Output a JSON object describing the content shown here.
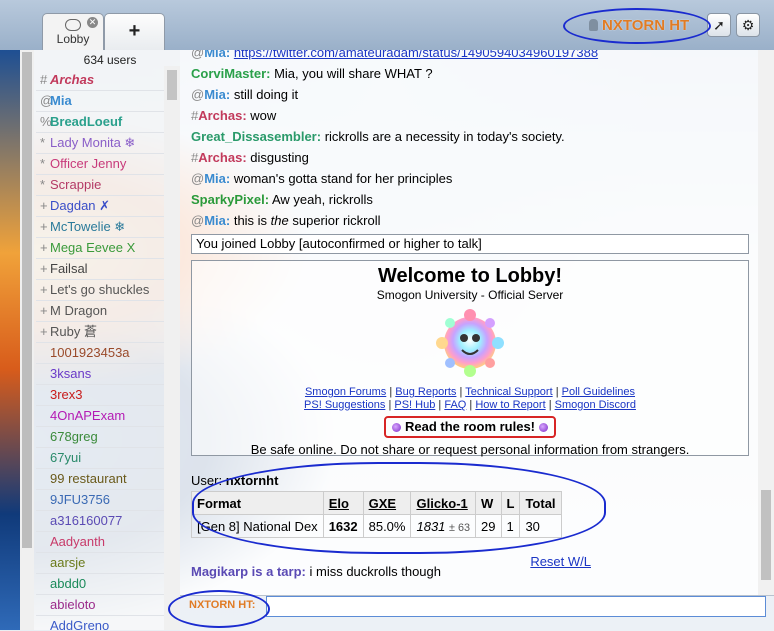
{
  "header": {
    "tabs": [
      {
        "label": "Lobby"
      }
    ],
    "add_tab_label": "+",
    "username": "NXTORN HT",
    "pm_icon": "arrow-icon",
    "settings_icon": "gear-icon"
  },
  "userlist": {
    "count_label": "634 users",
    "users": [
      {
        "rank": "#",
        "name": "Archas",
        "color": "#c23a5c",
        "style": "bolditalic"
      },
      {
        "rank": "@",
        "name": "Mia",
        "color": "#3a8bd0",
        "style": "bold"
      },
      {
        "rank": "%",
        "name": "BreadLoeuf",
        "color": "#2aa08c",
        "style": "bold"
      },
      {
        "rank": "*",
        "name": "Lady Monita ❄",
        "color": "#8a5ec8",
        "style": ""
      },
      {
        "rank": "*",
        "name": "Officer Jenny",
        "color": "#c83a7a",
        "style": ""
      },
      {
        "rank": "*",
        "name": "Scrappie",
        "color": "#b43a66",
        "style": ""
      },
      {
        "rank": "+",
        "name": "Dagdan ✗",
        "color": "#3a4ec8",
        "style": ""
      },
      {
        "rank": "+",
        "name": "McTowelie ❄",
        "color": "#2a7a9a",
        "style": ""
      },
      {
        "rank": "+",
        "name": "Mega Eevee X",
        "color": "#3a9a3a",
        "style": ""
      },
      {
        "rank": "+",
        "name": "Failsal",
        "color": "#444444",
        "style": ""
      },
      {
        "rank": "+",
        "name": "Let's go shuckles",
        "color": "#555555",
        "style": ""
      },
      {
        "rank": "+",
        "name": "M Dragon",
        "color": "#555555",
        "style": ""
      },
      {
        "rank": "+",
        "name": "Ruby 蒼",
        "color": "#555555",
        "style": ""
      },
      {
        "rank": "",
        "name": "1001923453a",
        "color": "#9a4a2a",
        "style": ""
      },
      {
        "rank": "",
        "name": "3ksans",
        "color": "#6a3ac8",
        "style": ""
      },
      {
        "rank": "",
        "name": "3rex3",
        "color": "#c81a1a",
        "style": ""
      },
      {
        "rank": "",
        "name": "4OnAPExam",
        "color": "#b41ab4",
        "style": ""
      },
      {
        "rank": "",
        "name": "678greg",
        "color": "#3a8a3a",
        "style": ""
      },
      {
        "rank": "",
        "name": "67yui",
        "color": "#2a8a6a",
        "style": ""
      },
      {
        "rank": "",
        "name": "99 restaurant",
        "color": "#6a5a1a",
        "style": ""
      },
      {
        "rank": "",
        "name": "9JFU3756",
        "color": "#3a6ab4",
        "style": ""
      },
      {
        "rank": "",
        "name": "a316160077",
        "color": "#5a4ab4",
        "style": ""
      },
      {
        "rank": "",
        "name": "Aadyanth",
        "color": "#c83a6a",
        "style": ""
      },
      {
        "rank": "",
        "name": "aarsje",
        "color": "#6a7a1a",
        "style": ""
      },
      {
        "rank": "",
        "name": "abdd0",
        "color": "#1a8a5a",
        "style": ""
      },
      {
        "rank": "",
        "name": "abieloto",
        "color": "#9a2a8a",
        "style": ""
      },
      {
        "rank": "",
        "name": "AddGreno",
        "color": "#3a5ac8",
        "style": ""
      }
    ]
  },
  "chat": {
    "messages": [
      {
        "sym": "@",
        "user": "Mia:",
        "color": "#3a8bd0",
        "text": "https://twitter.com/amateuradam/status/1490594034960197388"
      },
      {
        "sym": "",
        "user": "CorviMaster:",
        "color": "#2aa04a",
        "text": "Mia, you will share WHAT ?"
      },
      {
        "sym": "@",
        "user": "Mia:",
        "color": "#3a8bd0",
        "text": "still doing it"
      },
      {
        "sym": "#",
        "user": "Archas:",
        "color": "#c23a5c",
        "text": "wow"
      },
      {
        "sym": "",
        "user": "Great_Dissasembler:",
        "color": "#2a9a6a",
        "text": "rickrolls are a necessity in today's society."
      },
      {
        "sym": "#",
        "user": "Archas:",
        "color": "#c23a5c",
        "text": "disgusting"
      },
      {
        "sym": "@",
        "user": "Mia:",
        "color": "#3a8bd0",
        "text": "woman's gotta stand for her principles"
      },
      {
        "sym": "",
        "user": "SparkyPixel:",
        "color": "#2a9a3a",
        "text": "Aw yeah, rickrolls"
      },
      {
        "sym": "@",
        "user": "Mia:",
        "color": "#3a8bd0",
        "text_pre": "this is ",
        "text_em": "the",
        "text": " superior rickroll"
      }
    ],
    "notice": "You joined Lobby [autoconfirmed or higher to talk]",
    "welcome": {
      "title": "Welcome to Lobby!",
      "subtitle": "Smogon University - Official Server",
      "links_row1": [
        "Smogon Forums",
        "Bug Reports",
        "Technical Support",
        "Poll Guidelines"
      ],
      "links_row2": [
        "PS! Suggestions",
        "PS! Hub",
        "FAQ",
        "How to Report",
        "Smogon Discord"
      ],
      "rules_label": "Read the room rules!",
      "safety_text": "Be safe online. Do not share or request personal information from strangers."
    },
    "stats": {
      "user_label": "User:",
      "user_name": "nxtornht",
      "headers": [
        "Format",
        "Elo",
        "GXE",
        "Glicko-1",
        "W",
        "L",
        "Total"
      ],
      "row": {
        "format": "[Gen 8] National Dex",
        "elo": "1632",
        "gxe": "85.0%",
        "glicko": "1831",
        "glicko_dev": "± 63",
        "w": "29",
        "l": "1",
        "total": "30"
      },
      "reset_label": "Reset W/L"
    },
    "last_message": {
      "user": "Magikarp is a tarp:",
      "color": "#5a4ab4",
      "text": "i miss duckrolls though"
    }
  },
  "input": {
    "name_label": "NXTORN HT:",
    "value": ""
  }
}
